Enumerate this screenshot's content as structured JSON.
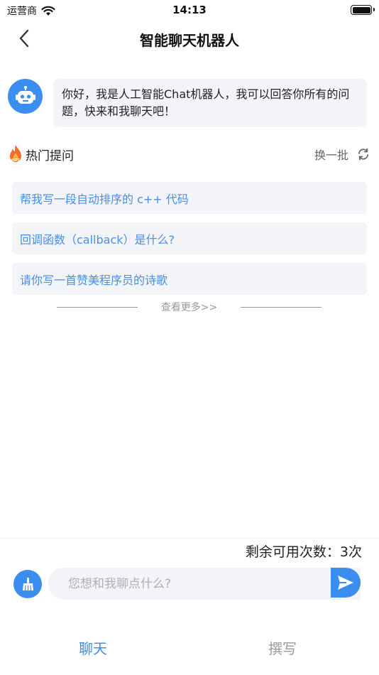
{
  "status_bar": {
    "carrier": "运营商",
    "time": "14:13"
  },
  "nav": {
    "title": "智能聊天机器人"
  },
  "bot": {
    "greeting": "你好，我是人工智能Chat机器人，我可以回答你所有的问题，快来和我聊天吧！"
  },
  "hot": {
    "title": "热门提问",
    "refresh_label": "换一批",
    "badge": "HOT",
    "questions": [
      "帮我写一段自动排序的 c++ 代码",
      "回调函数（callback）是什么?",
      "请你写一首赞美程序员的诗歌"
    ],
    "more_label": "查看更多>>"
  },
  "footer": {
    "remaining": "剩余可用次数：3次",
    "input_placeholder": "您想和我聊点什么?"
  },
  "tabs": [
    {
      "label": "聊天",
      "active": true
    },
    {
      "label": "撰写",
      "active": false
    }
  ],
  "colors": {
    "accent": "#3b8df0",
    "question_text": "#4a8ee6",
    "bubble_bg": "#f2f4f7"
  }
}
